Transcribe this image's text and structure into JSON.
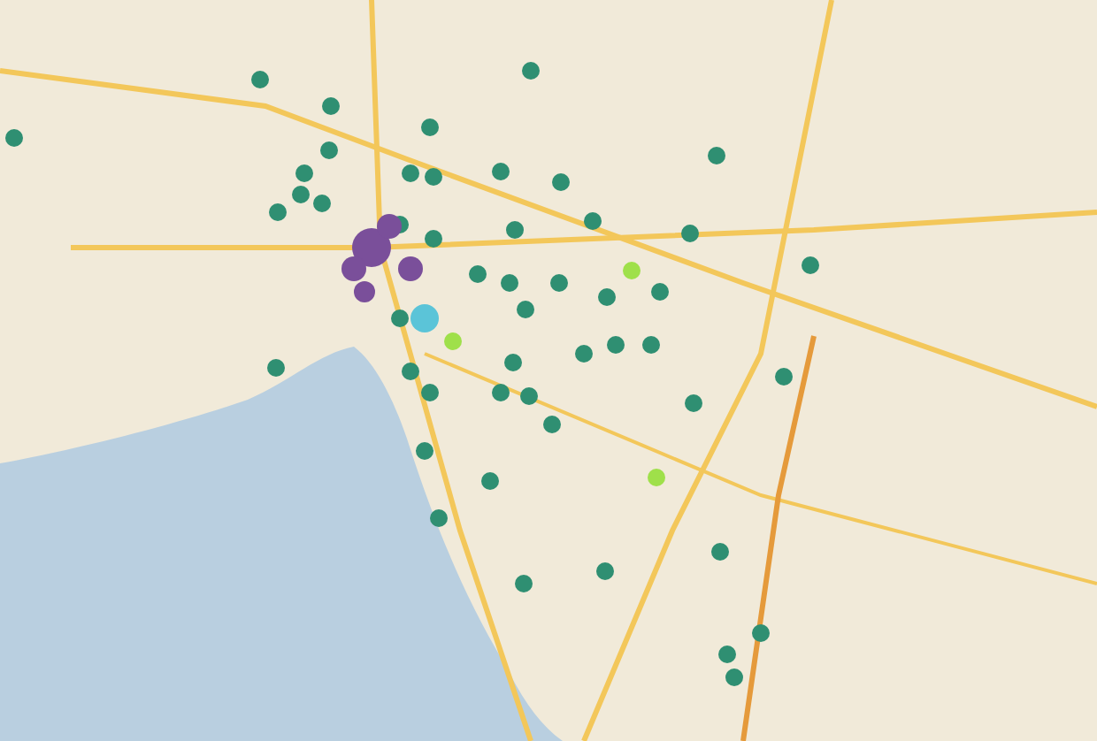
{
  "map": {
    "markers": [
      {
        "color": "#2f8f72"
      },
      {
        "color": "#2f8f72"
      },
      {
        "color": "#2f8f72"
      },
      {
        "color": "#2f8f72"
      },
      {
        "color": "#2f8f72"
      },
      {
        "color": "#2f8f72"
      },
      {
        "color": "#2f8f72"
      },
      {
        "color": "#2f8f72"
      },
      {
        "color": "#2f8f72"
      },
      {
        "color": "#2f8f72"
      },
      {
        "color": "#2f8f72"
      },
      {
        "color": "#2f8f72"
      },
      {
        "color": "#2f8f72"
      },
      {
        "color": "#2f8f72"
      },
      {
        "color": "#2f8f72"
      },
      {
        "color": "#2f8f72"
      },
      {
        "color": "#2f8f72"
      },
      {
        "color": "#2f8f72"
      },
      {
        "color": "#2f8f72"
      },
      {
        "color": "#2f8f72"
      },
      {
        "color": "#2f8f72"
      },
      {
        "color": "#2f8f72"
      },
      {
        "color": "#2f8f72"
      },
      {
        "color": "#2f8f72"
      },
      {
        "color": "#2f8f72"
      },
      {
        "color": "#2f8f72"
      },
      {
        "color": "#2f8f72"
      },
      {
        "color": "#2f8f72"
      },
      {
        "color": "#2f8f72"
      },
      {
        "color": "#2f8f72"
      },
      {
        "color": "#2f8f72"
      },
      {
        "color": "#2f8f72"
      },
      {
        "color": "#2f8f72"
      },
      {
        "color": "#2f8f72"
      },
      {
        "color": "#2f8f72"
      },
      {
        "color": "#2f8f72"
      },
      {
        "color": "#2f8f72"
      },
      {
        "color": "#2f8f72"
      },
      {
        "color": "#2f8f72"
      },
      {
        "color": "#2f8f72"
      },
      {
        "color": "#2f8f72"
      },
      {
        "color": "#2f8f72"
      },
      {
        "color": "#2f8f72"
      },
      {
        "color": "#2f8f72"
      },
      {
        "color": "#2f8f72"
      },
      {
        "color": "#2f8f72"
      },
      {
        "color": "#2f8f72"
      },
      {
        "color": "#2f8f72"
      },
      {
        "color": "#2f8f72"
      },
      {
        "color": "#9fe04a"
      },
      {
        "color": "#9fe04a"
      },
      {
        "color": "#9fe04a"
      },
      {
        "color": "#7a4f9a"
      },
      {
        "color": "#7a4f9a"
      },
      {
        "color": "#7a4f9a"
      },
      {
        "color": "#7a4f9a"
      },
      {
        "color": "#7a4f9a"
      },
      {
        "color": "#5bc4d8"
      }
    ]
  }
}
